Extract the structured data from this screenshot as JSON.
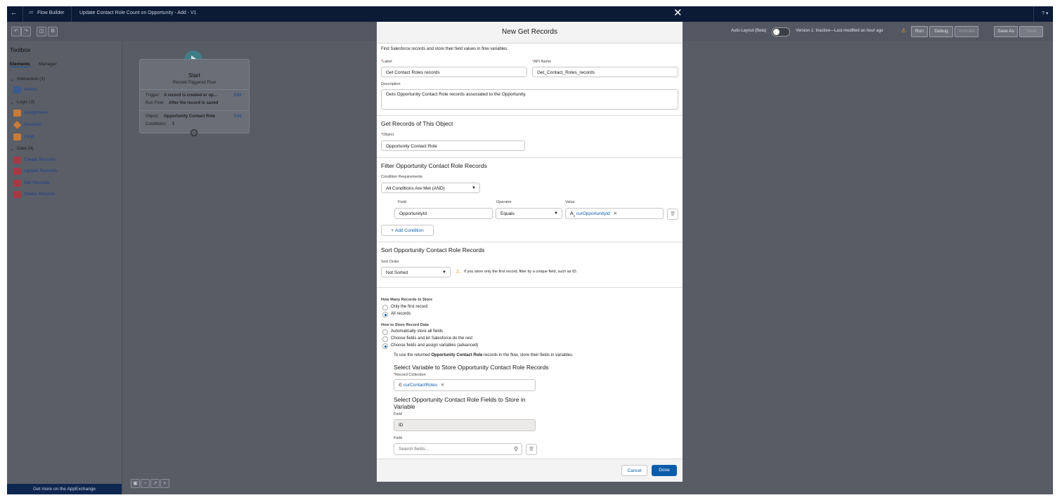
{
  "header": {
    "app_name": "Flow Builder",
    "flow_title": "Update Contact Role Count on Opportunity - Add - V1",
    "help": "? ▾"
  },
  "toolbar": {
    "auto_layout": "Auto-Layout (Beta)",
    "version_status": "Version 1: Inactive—Last modified an hour ago",
    "run": "Run",
    "debug": "Debug",
    "activate": "Activate",
    "save_as": "Save As",
    "save": "Save"
  },
  "toolbox": {
    "title": "Toolbox",
    "tabs": [
      "Elements",
      "Manager"
    ],
    "groups": [
      {
        "label": "Interaction (1)",
        "items": [
          "Action"
        ]
      },
      {
        "label": "Logic (3)",
        "items": [
          "Assignment",
          "Decision",
          "Loop"
        ]
      },
      {
        "label": "Data (4)",
        "items": [
          "Create Records",
          "Update Records",
          "Get Records",
          "Delete Records"
        ]
      }
    ],
    "appexchange": "Get more on the AppExchange"
  },
  "start_card": {
    "title": "Start",
    "subtitle": "Record-Triggered Flow",
    "trigger_label": "Trigger:",
    "trigger_value": "A record is created or up...",
    "runflow_label": "Run Flow:",
    "runflow_value": "After the record is saved",
    "object_label": "Object:",
    "object_value": "Opportunity Contact Role",
    "conditions_label": "Conditions:",
    "conditions_value": "1",
    "edit": "Edit"
  },
  "modal": {
    "title": "New Get Records",
    "intro": "Find Salesforce records and store their field values in flow variables.",
    "label_label": "Label",
    "label_value": "Get Contact Roles records",
    "api_label": "API Name",
    "api_value": "Get_Contact_Roles_records",
    "desc_label": "Description",
    "desc_value": "Gets Opportunity Contact Role records associated to the Opportunity.",
    "object_section": "Get Records of This Object",
    "object_label": "Object",
    "object_value": "Opportunity Contact Role",
    "filter_section": "Filter Opportunity Contact Role Records",
    "cond_req_label": "Condition Requirements",
    "cond_req_value": "All Conditions Are Met (AND)",
    "field_col": "Field",
    "operator_col": "Operator",
    "value_col": "Value",
    "field_value": "OpportunityId",
    "operator_value": "Equals",
    "value_value": "curOpportunityId",
    "add_condition": "Add Condition",
    "sort_section": "Sort Opportunity Contact Role Records",
    "sort_order_label": "Sort Order",
    "sort_order_value": "Not Sorted",
    "sort_hint": "If you store only the first record, filter by a unique field, such as ID.",
    "how_many_label": "How Many Records to Store",
    "how_many_options": [
      "Only the first record",
      "All records"
    ],
    "how_store_label": "How to Store Record Data",
    "how_store_options": [
      "Automatically store all fields",
      "Choose fields and let Salesforce do the rest",
      "Choose fields and assign variables (advanced)"
    ],
    "use_text_a": "To use the returned",
    "use_text_b": "Opportunity Contact Role",
    "use_text_c": "records in the flow, store their fields in variables.",
    "select_var_title": "Select Variable to Store Opportunity Contact Role Records",
    "record_coll_label": "Record Collection",
    "record_coll_value": "curContactRoles",
    "select_fields_title": "Select Opportunity Contact Role Fields to Store in Variable",
    "field_label": "Field",
    "field_id": "ID",
    "field_label2": "Field",
    "search_placeholder": "Search fields...",
    "cancel": "Cancel",
    "done": "Done"
  }
}
